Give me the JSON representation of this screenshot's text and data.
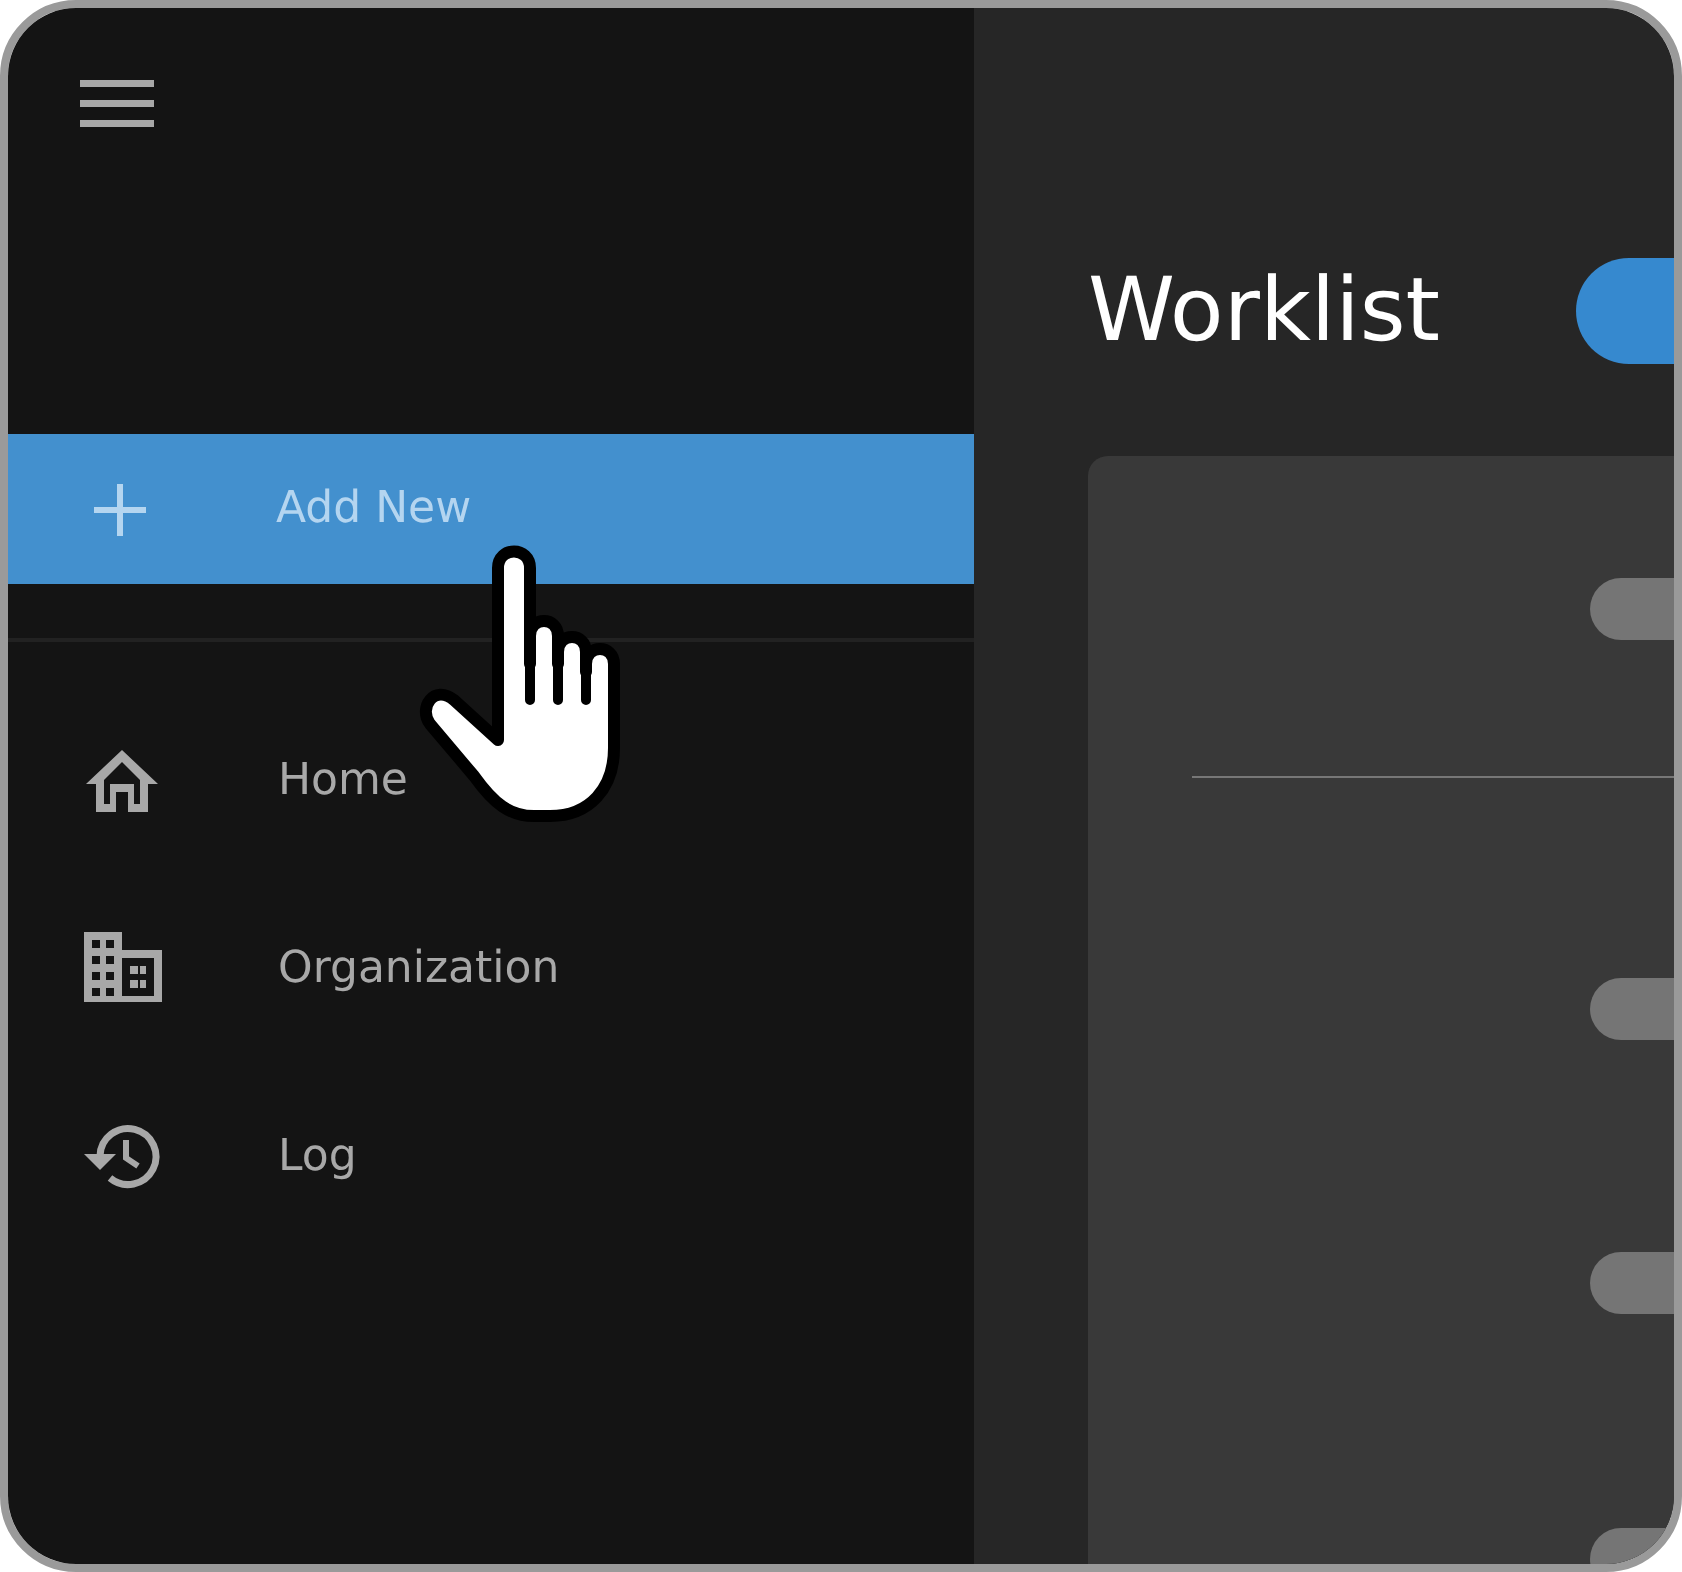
{
  "sidebar": {
    "add_item": {
      "label": "Add New",
      "selected": true
    },
    "items": [
      {
        "label": "Home",
        "kind": "home",
        "selected": false
      },
      {
        "label": "Organization",
        "kind": "organization",
        "selected": false
      },
      {
        "label": "Log",
        "kind": "log",
        "selected": false
      }
    ]
  },
  "main": {
    "title": "Worklist"
  }
}
